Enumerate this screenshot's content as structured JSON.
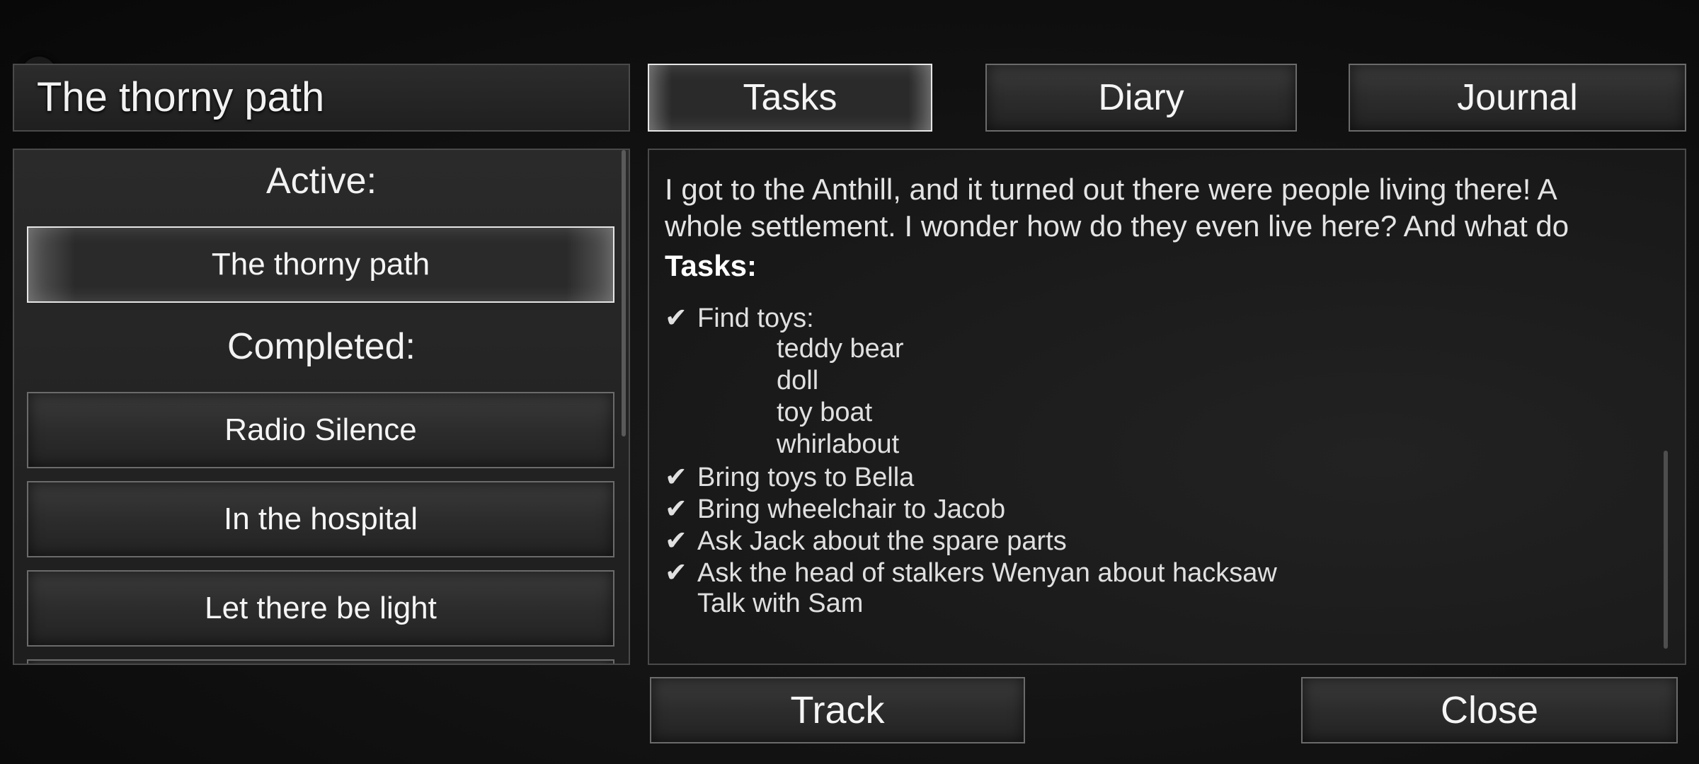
{
  "header": {
    "quest_title": "The thorny path"
  },
  "tabs": [
    {
      "label": "Tasks",
      "selected": true
    },
    {
      "label": "Diary",
      "selected": false
    },
    {
      "label": "Journal",
      "selected": false
    }
  ],
  "quest_list": {
    "active_heading": "Active:",
    "active": [
      {
        "label": "The thorny path",
        "selected": true
      }
    ],
    "completed_heading": "Completed:",
    "completed": [
      {
        "label": "Radio Silence"
      },
      {
        "label": "In the hospital"
      },
      {
        "label": "Let there be light"
      }
    ]
  },
  "details": {
    "intro_line1": "I got to the Anthill, and it turned out there were people living there! A",
    "intro_line2": "whole settlement. I wonder how do they even live here? And what do",
    "tasks_heading": "Tasks:",
    "check_glyph": "✔",
    "tasks": [
      {
        "text": "Find toys:",
        "done": true,
        "sub": [
          "teddy bear",
          "doll",
          "toy boat",
          "whirlabout"
        ]
      },
      {
        "text": "Bring toys to Bella",
        "done": true
      },
      {
        "text": "Bring wheelchair to Jacob",
        "done": true
      },
      {
        "text": "Ask Jack about the spare parts",
        "done": true
      },
      {
        "text": "Ask the head of stalkers Wenyan about hacksaw",
        "done": true
      },
      {
        "text": "Talk with Sam",
        "done": false
      }
    ]
  },
  "footer": {
    "track_label": "Track",
    "close_label": "Close"
  }
}
